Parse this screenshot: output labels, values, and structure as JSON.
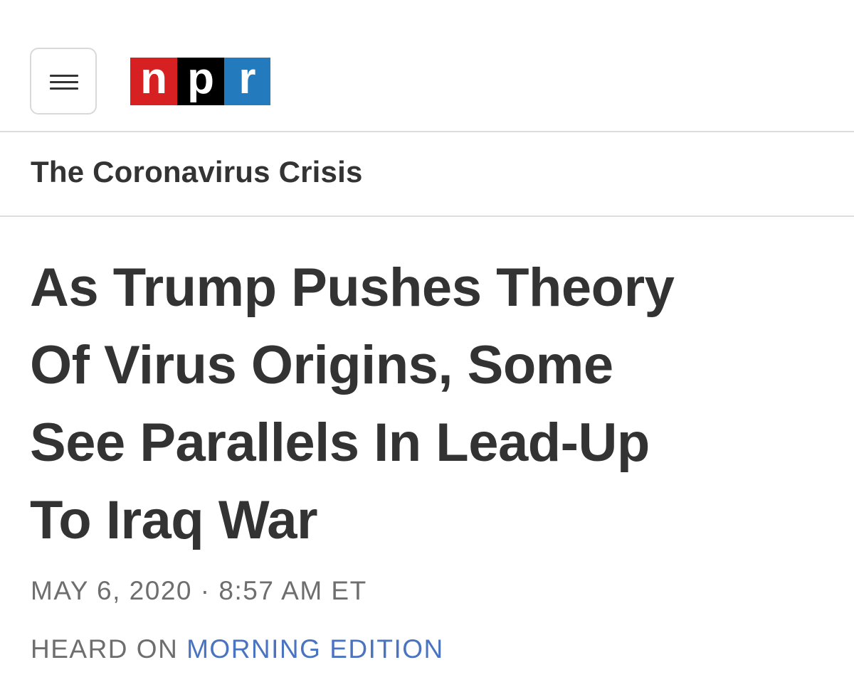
{
  "header": {
    "menu_icon": "hamburger-menu-icon",
    "logo": {
      "letters": [
        {
          "char": "n",
          "color": "#d62021"
        },
        {
          "char": "p",
          "color": "#000000"
        },
        {
          "char": "r",
          "color": "#237bbd"
        }
      ]
    }
  },
  "section": {
    "label": "The Coronavirus Crisis"
  },
  "article": {
    "headline_lines": [
      "As Trump Pushes Theory",
      "Of Virus Origins, Some",
      "See Parallels In Lead-Up",
      "To Iraq War"
    ],
    "date": "MAY 6, 2020",
    "separator": "·",
    "time": "8:57 AM ET",
    "heard_on_prefix": "HEARD ON",
    "program": "MORNING EDITION"
  },
  "colors": {
    "text": "#333333",
    "meta": "#6e6e6e",
    "link": "#4a74c1",
    "divider": "#dcdcdc"
  }
}
